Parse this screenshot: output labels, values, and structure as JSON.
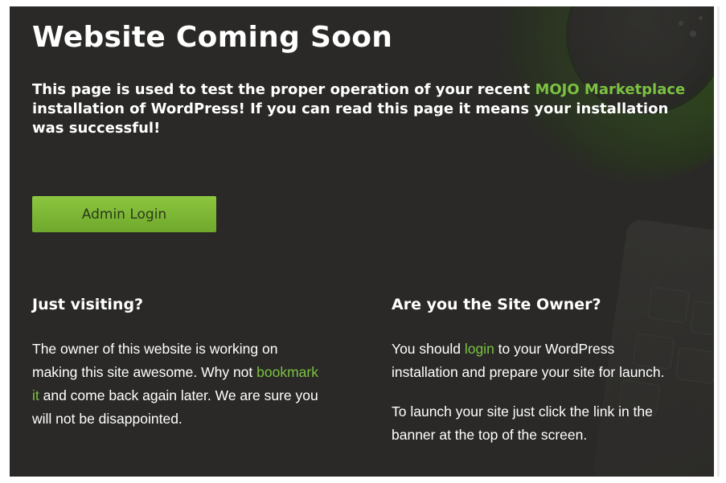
{
  "page": {
    "title": "Website Coming Soon",
    "intro_part1": "This page is used to test the proper operation of your recent ",
    "intro_link": "MOJO Marketplace",
    "intro_part2": " installation of WordPress! If you can read this page it means your installation was successful!",
    "admin_button": "Admin Login"
  },
  "visiting": {
    "heading": "Just visiting?",
    "text1": "The owner of this website is working on making this site awesome. Why not ",
    "link": "bookmark it",
    "text2": " and come back again later. We are sure you will not be disappointed."
  },
  "owner": {
    "heading": "Are you the Site Owner?",
    "text1": "You should ",
    "link": "login",
    "text2": " to your WordPress installation and prepare your site for launch.",
    "para2": "To launch your site just click the link in the banner at the top of the screen."
  },
  "colors": {
    "accent": "#7bc142",
    "button": "#7db63a",
    "background": "#2a2927"
  }
}
